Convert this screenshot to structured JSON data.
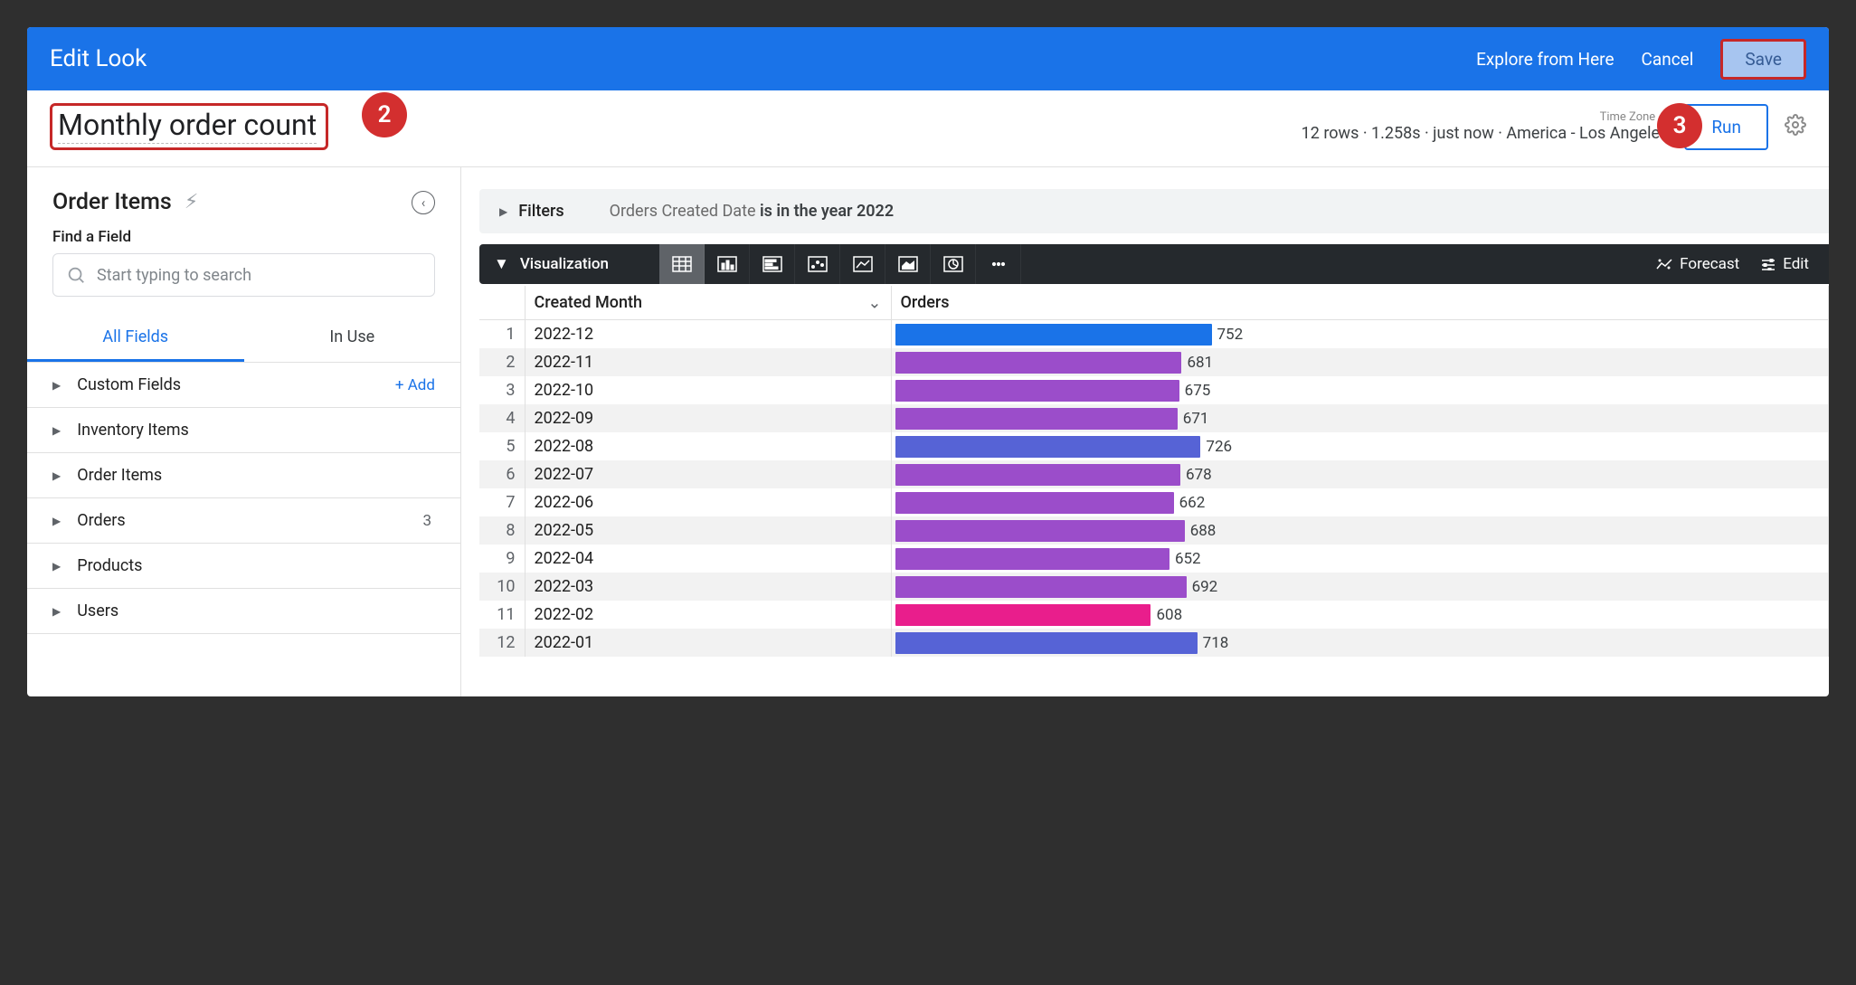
{
  "header": {
    "title": "Edit Look",
    "explore": "Explore from Here",
    "cancel": "Cancel",
    "save": "Save"
  },
  "look": {
    "title": "Monthly order count",
    "timezone_label": "Time Zone ⌄",
    "status": "12 rows · 1.258s · just now · America - Los Angeles",
    "run": "Run"
  },
  "sidebar": {
    "explore_title": "Order Items",
    "find_label": "Find a Field",
    "search_placeholder": "Start typing to search",
    "tabs": {
      "all": "All Fields",
      "in_use": "In Use"
    },
    "custom_fields": {
      "label": "Custom Fields",
      "add": "+  Add"
    },
    "groups": [
      {
        "label": "Inventory Items"
      },
      {
        "label": "Order Items"
      },
      {
        "label": "Orders",
        "count": "3"
      },
      {
        "label": "Products"
      },
      {
        "label": "Users"
      }
    ]
  },
  "filters": {
    "head": "Filters",
    "prefix": "Orders Created Date ",
    "bold": "is in the year 2022"
  },
  "viz": {
    "label": "Visualization",
    "forecast": "Forecast",
    "edit": "Edit"
  },
  "table": {
    "columns": {
      "created": "Created Month",
      "orders": "Orders"
    }
  },
  "callouts": {
    "two": "2",
    "three": "3"
  },
  "chart_data": {
    "type": "table",
    "columns": [
      "Created Month",
      "Orders"
    ],
    "max_value": 752,
    "rows": [
      {
        "idx": 1,
        "created": "2022-12",
        "orders": 752,
        "color": "#1a73e8"
      },
      {
        "idx": 2,
        "created": "2022-11",
        "orders": 681,
        "color": "#9b4dca"
      },
      {
        "idx": 3,
        "created": "2022-10",
        "orders": 675,
        "color": "#9b4dca"
      },
      {
        "idx": 4,
        "created": "2022-09",
        "orders": 671,
        "color": "#9b4dca"
      },
      {
        "idx": 5,
        "created": "2022-08",
        "orders": 726,
        "color": "#5663d6"
      },
      {
        "idx": 6,
        "created": "2022-07",
        "orders": 678,
        "color": "#9b4dca"
      },
      {
        "idx": 7,
        "created": "2022-06",
        "orders": 662,
        "color": "#9b4dca"
      },
      {
        "idx": 8,
        "created": "2022-05",
        "orders": 688,
        "color": "#9b4dca"
      },
      {
        "idx": 9,
        "created": "2022-04",
        "orders": 652,
        "color": "#9b4dca"
      },
      {
        "idx": 10,
        "created": "2022-03",
        "orders": 692,
        "color": "#9b4dca"
      },
      {
        "idx": 11,
        "created": "2022-02",
        "orders": 608,
        "color": "#e91e8c"
      },
      {
        "idx": 12,
        "created": "2022-01",
        "orders": 718,
        "color": "#5663d6"
      }
    ]
  }
}
